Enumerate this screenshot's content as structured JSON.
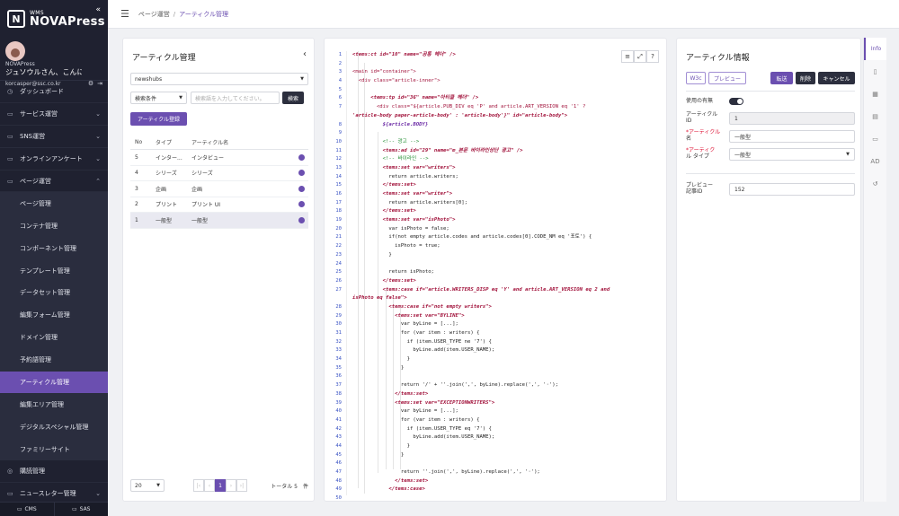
{
  "brand": {
    "small": "WMS",
    "big": "NOVAPress",
    "mark": "N"
  },
  "user": {
    "org": "NOVAPress",
    "name": "ジュソウルさん、こんにちは",
    "email": "korcasper@ssc.co.kr"
  },
  "sidebar": {
    "items": [
      {
        "label": "ダッシュボード",
        "icon": "◷",
        "type": "top"
      },
      {
        "label": "サービス運営",
        "icon": "▭",
        "type": "top",
        "chev": "⌄"
      },
      {
        "label": "SNS運営",
        "icon": "▭",
        "type": "top",
        "chev": "⌄"
      },
      {
        "label": "オンラインアンケート",
        "icon": "▭",
        "type": "top",
        "chev": "⌄"
      },
      {
        "label": "ページ運営",
        "icon": "▭",
        "type": "top",
        "chev": "⌃"
      },
      {
        "label": "ページ管理",
        "type": "sub"
      },
      {
        "label": "コンテナ管理",
        "type": "sub"
      },
      {
        "label": "コンポーネント管理",
        "type": "sub"
      },
      {
        "label": "テンプレート管理",
        "type": "sub"
      },
      {
        "label": "データセット管理",
        "type": "sub"
      },
      {
        "label": "編集フォーム管理",
        "type": "sub"
      },
      {
        "label": "ドメイン管理",
        "type": "sub"
      },
      {
        "label": "予約語管理",
        "type": "sub"
      },
      {
        "label": "アーティクル管理",
        "type": "sub",
        "active": true
      },
      {
        "label": "編集エリア管理",
        "type": "sub"
      },
      {
        "label": "デジタルスペシャル管理",
        "type": "sub"
      },
      {
        "label": "ファミリーサイト",
        "type": "sub"
      },
      {
        "label": "購読管理",
        "icon": "◎",
        "type": "top"
      },
      {
        "label": "ニュースレター管理",
        "icon": "▭",
        "type": "top",
        "chev": "⌄"
      }
    ],
    "footer": {
      "cms": "CMS",
      "sas": "SAS"
    }
  },
  "breadcrumb": {
    "parent": "ページ運営",
    "sep": "/",
    "current": "アーティクル管理"
  },
  "left_panel": {
    "title": "アーティクル管理",
    "site_select": "newshubs",
    "search_condition": "検索条件",
    "search_placeholder": "検索語を入力してください。",
    "search_button": "検索",
    "register_button": "アーティクル登録",
    "columns": {
      "no": "No",
      "type": "タイプ",
      "name": "アーティクル名"
    },
    "rows": [
      {
        "no": "5",
        "type": "インター...",
        "name": "インタビュー"
      },
      {
        "no": "4",
        "type": "シリーズ",
        "name": "シリーズ"
      },
      {
        "no": "3",
        "type": "企画",
        "name": "企画"
      },
      {
        "no": "2",
        "type": "プリント",
        "name": "プリント UI"
      },
      {
        "no": "1",
        "type": "一般型",
        "name": "一般型"
      }
    ],
    "page_size": "20",
    "page_current": "1",
    "total_label": "トータル 5　件"
  },
  "code_lines": [
    "1",
    "2",
    "3",
    "4",
    "5",
    "6",
    "7",
    "8",
    "9",
    "10",
    "11",
    "12",
    "13",
    "14",
    "15",
    "16",
    "17",
    "18",
    "19",
    "20",
    "21",
    "22",
    "23",
    "24",
    "25",
    "26",
    "27",
    "28",
    "29",
    "30",
    "31",
    "32",
    "33",
    "34",
    "35",
    "36",
    "37",
    "38",
    "39",
    "40",
    "41",
    "42",
    "43",
    "44",
    "45",
    "46",
    "47",
    "48",
    "49",
    "50"
  ],
  "code": {
    "l1a": "<tems:ct",
    "l1b": " id=\"10\" name=\"공통 헤더\" />",
    "l3": "<main id=\"container\">",
    "l4": "  <div class=\"article-inner\">",
    "l6a": "      <tems:tp",
    "l6b": " id=\"36\" name=\"아티클 헤더\" />",
    "l7a": "        <div class=\"${article.PUB_DIV eq 'P' and article.ART_VERSION eq '1' ?",
    "l7b": "'article-body paper-article-body' : 'article-body'}\" id=\"article-body\">",
    "l8": "          ${article.BODY}",
    "l10": "          <!-- 광고 -->",
    "l11a": "          <tems:ad",
    "l11b": " id=\"29\" name=\"m_본문 바이라인상단 광고\" />",
    "l12": "          <!-- 바이라인 -->",
    "l13": "          <tems:set var=\"writers\">",
    "l14": "            return article.writers;",
    "l15": "          </tems:set>",
    "l16": "          <tems:set var=\"writer\">",
    "l17": "            return article.writers[0];",
    "l18": "          </tems:set>",
    "l19": "          <tems:set var=\"isPhoto\">",
    "l20": "            var isPhoto = false;",
    "l21": "            if(not empty article.codes and article.codes[0].CODE_NM eq '포토') {",
    "l22": "              isPhoto = true;",
    "l23": "            }",
    "l25": "            return isPhoto;",
    "l26": "          </tems:set>",
    "l27a": "          <tems:case if=\"article.WRITERS_DISP eq 'Y' and article.ART_VERSION eq 2 and",
    "l27b": "isPhoto eq false\">",
    "l28": "            <tems:case if=\"not empty writers\">",
    "l29": "              <tems:set var=\"BYLINE\">",
    "l30": "                var byLine = [...];",
    "l31": "                for (var item : writers) {",
    "l32": "                  if (item.USER_TYPE ne '7') {",
    "l33": "                    byLine.add(item.USER_NAME);",
    "l34": "                  }",
    "l35": "                }",
    "l37": "                return '/' + ''.join(',', byLine).replace(',', '·');",
    "l38": "              </tems:set>",
    "l39": "              <tems:set var=\"EXCEPTIONWRITERS\">",
    "l40": "                var byLine = [...];",
    "l41": "                for (var item : writers) {",
    "l42": "                  if (item.USER_TYPE eq '7') {",
    "l43": "                    byLine.add(item.USER_NAME);",
    "l44": "                  }",
    "l45": "                }",
    "l47": "                return ''.join(',', byLine).replace(',', '·');",
    "l48": "              </tems:set>",
    "l49": "            </tems:case>"
  },
  "right_panel": {
    "title": "アーティクル情報",
    "w3c": "W3c",
    "preview": "プレビュー",
    "transfer": "転送",
    "delete": "削除",
    "cancel": "キャンセル",
    "use_label": "使用の有無",
    "id_label_1": "アーティクル",
    "id_label_2": "ID",
    "id_value": "1",
    "name_label_1": "*アーティクル",
    "name_label_2": "名",
    "name_value": "一般型",
    "type_label_1": "*アーティク",
    "type_label_2": "ル タイプ",
    "type_value": "一般型",
    "preview_label_1": "プレビュー",
    "preview_label_2": "記事ID",
    "preview_value": "152"
  },
  "rail": {
    "info": "Info",
    "ad": "AD"
  },
  "colors": {
    "accent": "#6b4fb0",
    "sidebar": "#1f2130"
  }
}
